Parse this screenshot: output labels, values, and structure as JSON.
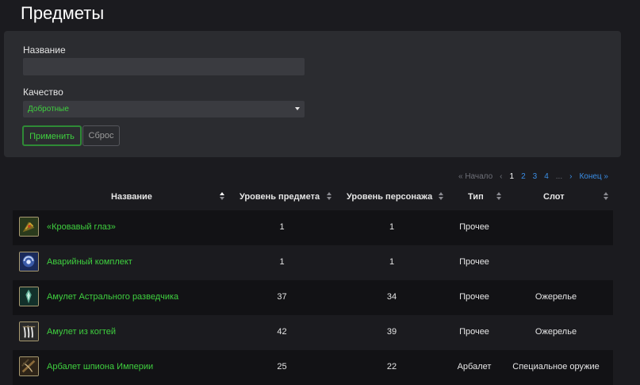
{
  "page": {
    "title": "Предметы"
  },
  "filters": {
    "name_label": "Название",
    "name_value": "",
    "quality_label": "Качество",
    "quality_value": "Добротные",
    "apply_label": "Применить",
    "reset_label": "Сброс"
  },
  "pagination": {
    "first": "« Начало",
    "prev": "‹",
    "pages": [
      "1",
      "2",
      "3",
      "4"
    ],
    "current": "1",
    "ellipsis": "...",
    "next": "›",
    "last": "Конец »"
  },
  "table": {
    "headers": {
      "name": "Название",
      "item_level": "Уровень предмета",
      "char_level": "Уровень персонажа",
      "type": "Тип",
      "slot": "Слот"
    },
    "rows": [
      {
        "icon": "red-eye-gem-icon",
        "name": "«Кровавый глаз»",
        "item_level": "1",
        "char_level": "1",
        "type": "Прочее",
        "slot": ""
      },
      {
        "icon": "emergency-kit-icon",
        "name": "Аварийный комплект",
        "item_level": "1",
        "char_level": "1",
        "type": "Прочее",
        "slot": ""
      },
      {
        "icon": "astral-amulet-icon",
        "name": "Амулет Астрального разведчика",
        "item_level": "37",
        "char_level": "34",
        "type": "Прочее",
        "slot": "Ожерелье"
      },
      {
        "icon": "claw-amulet-icon",
        "name": "Амулет из когтей",
        "item_level": "42",
        "char_level": "39",
        "type": "Прочее",
        "slot": "Ожерелье"
      },
      {
        "icon": "crossbow-icon",
        "name": "Арбалет шпиона Империи",
        "item_level": "25",
        "char_level": "22",
        "type": "Арбалет",
        "slot": "Специальное оружие"
      }
    ]
  },
  "colors": {
    "background": "#1b1b1f",
    "panel": "#2b2c30",
    "quality_green": "#3fd03f",
    "link_blue": "#3a8ee6"
  }
}
